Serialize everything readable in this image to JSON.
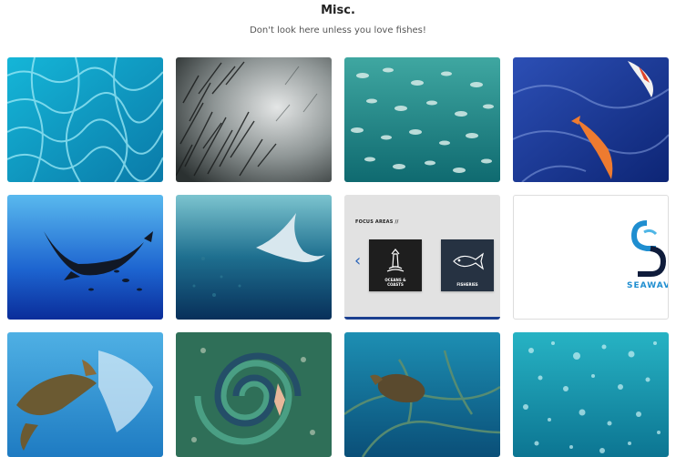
{
  "header": {
    "title": "Misc.",
    "subtitle": "Don't look here unless you love fishes!"
  },
  "gallery": {
    "focus_card": {
      "title": "FOCUS AREAS //",
      "items": [
        {
          "label_line1": "OCEANS &",
          "label_line2": "COASTS",
          "icon": "lighthouse-icon"
        },
        {
          "label_line1": "FISHERIES",
          "label_line2": "",
          "icon": "fish-icon"
        }
      ],
      "nav_icon": "chevron-left-icon"
    },
    "seawave_card": {
      "wordmark": "SEAWAV"
    },
    "photos": [
      {
        "subject": "caustic-water-surface"
      },
      {
        "subject": "school-of-sardines"
      },
      {
        "subject": "school-of-fish"
      },
      {
        "subject": "koi-fish"
      },
      {
        "subject": "manta-ray-blue"
      },
      {
        "subject": "manta-ray-deep"
      },
      {
        "subject": "sea-turtle-plastic-bag"
      },
      {
        "subject": "diver-in-plastic-spiral"
      },
      {
        "subject": "turtle-in-fishing-net"
      },
      {
        "subject": "underwater-bubbles"
      }
    ]
  },
  "colors": {
    "accent_blue": "#1b3f8f",
    "chevron_blue": "#2a64b9",
    "seawave_blue": "#1f8ed0"
  }
}
